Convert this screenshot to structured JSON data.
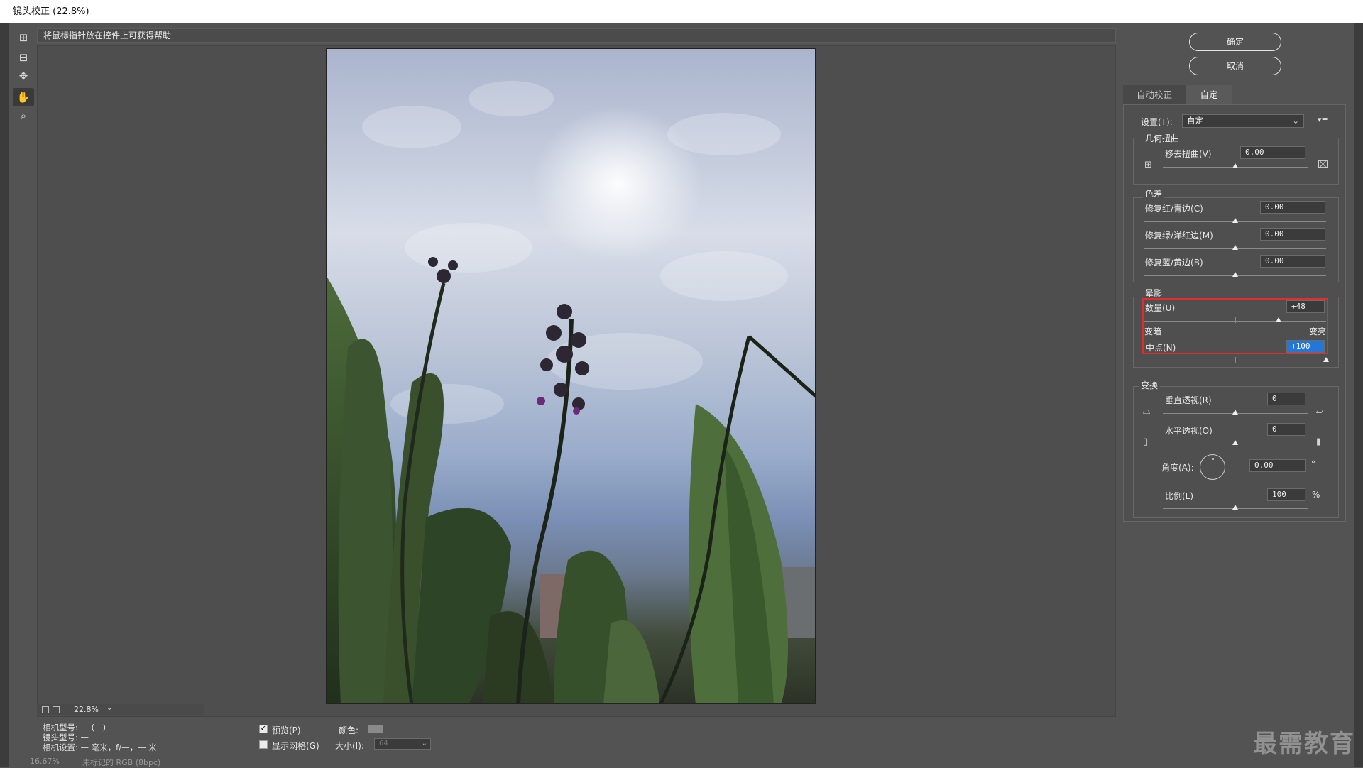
{
  "window": {
    "title": "镜头校正 (22.8%)"
  },
  "help": {
    "text": "将鼠标指针放在控件上可获得帮助"
  },
  "toolbar": {
    "tools": [
      {
        "name": "remove-distortion-tool",
        "glyph": "⊞"
      },
      {
        "name": "straighten-tool",
        "glyph": "⊟"
      },
      {
        "name": "move-grid-tool",
        "glyph": "✥"
      },
      {
        "name": "hand-tool",
        "glyph": "✋"
      },
      {
        "name": "zoom-tool",
        "glyph": "⌕"
      }
    ]
  },
  "buttons": {
    "ok": "确定",
    "cancel": "取消"
  },
  "tabs": {
    "auto": "自动校正",
    "custom": "自定"
  },
  "settings": {
    "label": "设置(T):",
    "value": "自定",
    "menu_icon": "▾≡"
  },
  "geometric": {
    "title": "几何扭曲",
    "remove_distortion_label": "移去扭曲(V)",
    "remove_distortion_value": "0.00"
  },
  "chromatic": {
    "title": "色差",
    "red_cyan_label": "修复红/青边(C)",
    "red_cyan_value": "0.00",
    "green_magenta_label": "修复绿/洋红边(M)",
    "green_magenta_value": "0.00",
    "blue_yellow_label": "修复蓝/黄边(B)",
    "blue_yellow_value": "0.00"
  },
  "vignette": {
    "title": "晕影",
    "amount_label": "数量(U)",
    "amount_value": "+48",
    "amount_fraction": 0.74,
    "darken_label": "变暗",
    "lighten_label": "变亮",
    "midpoint_label": "中点(N)",
    "midpoint_value": "+100",
    "midpoint_fraction": 1.0
  },
  "transform": {
    "title": "变换",
    "vertical_label": "垂直透视(R)",
    "vertical_value": "0",
    "horizontal_label": "水平透视(O)",
    "horizontal_value": "0",
    "angle_label": "角度(A):",
    "angle_value": "0.00",
    "angle_unit": "°",
    "scale_label": "比例(L)",
    "scale_value": "100",
    "scale_unit": "%"
  },
  "zoom": {
    "value": "22.8%"
  },
  "camera": {
    "model_label": "相机型号:",
    "model_value": "— (—)",
    "lens_label": "镜头型号:",
    "lens_value": "—",
    "settings_label": "相机设置:",
    "settings_value": "— 毫米，f/—，— 米"
  },
  "options": {
    "preview_label": "预览(P)",
    "preview_checked": true,
    "grid_label": "显示网格(G)",
    "grid_checked": false,
    "color_label": "颜色:",
    "size_label": "大小(I):",
    "size_value": "64"
  },
  "statusbar": {
    "zoom": "16.67%",
    "info": "未标记的 RGB (8bpc)"
  },
  "watermark": {
    "text": "最需教育"
  }
}
